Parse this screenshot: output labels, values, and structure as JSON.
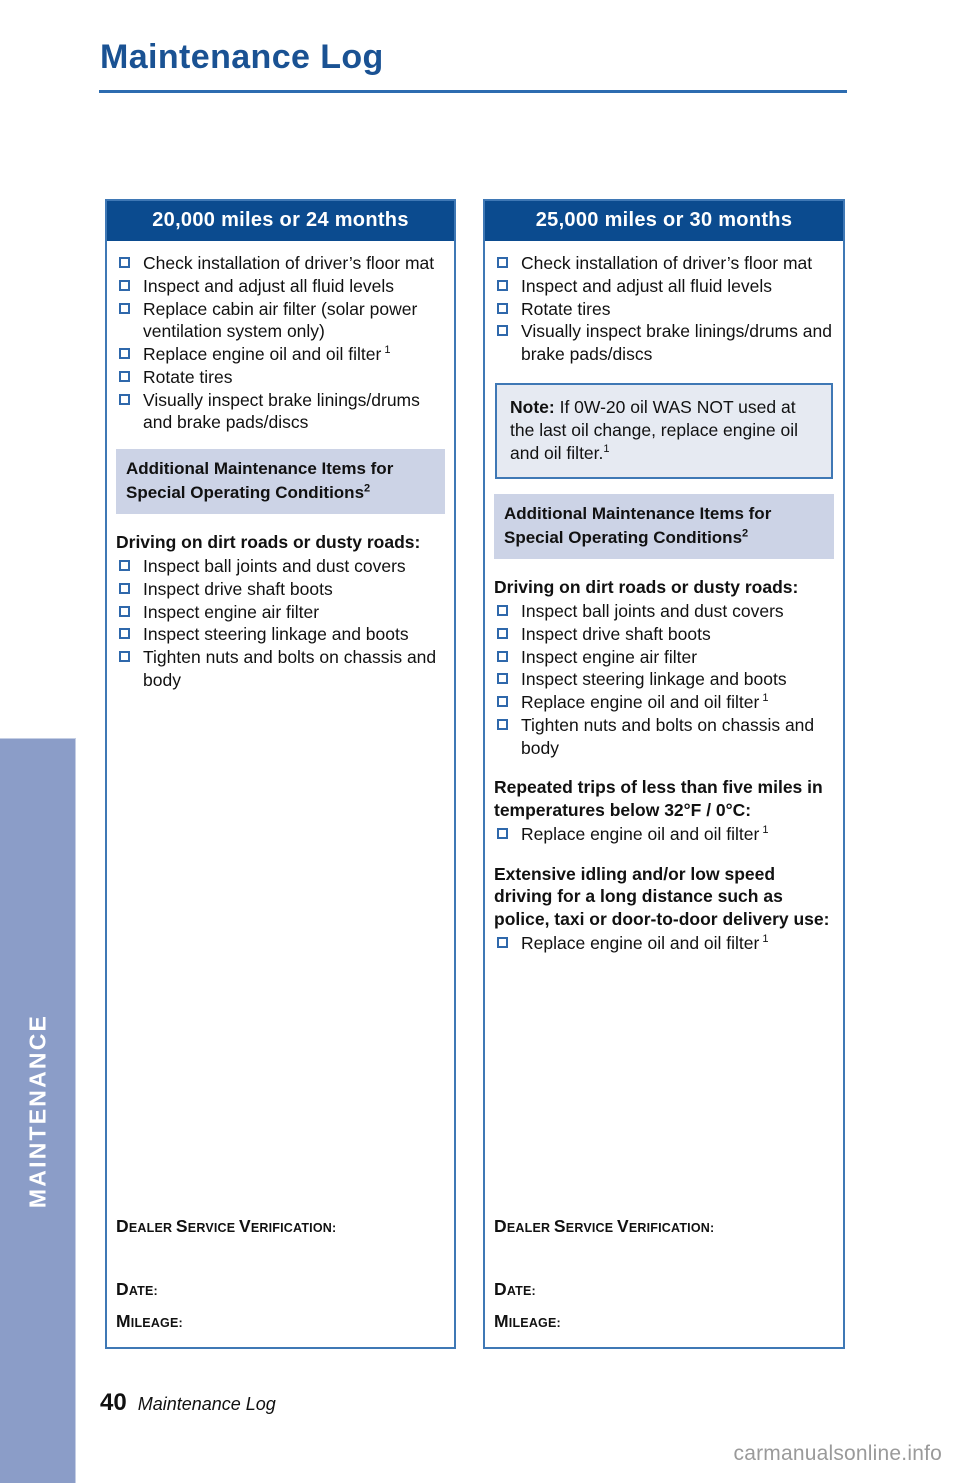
{
  "page": {
    "title": "Maintenance Log",
    "side_tab": "MAINTENANCE",
    "folio_number": "40",
    "folio_label": "Maintenance Log",
    "watermark": "carmanualsonline.info",
    "accent_blue": "#1a5293",
    "header_band": "#0b4b8f",
    "rule_blue": "#2d6cb0",
    "box_border": "#3f78b5",
    "gray_band": "#ccd3e6",
    "note_fill": "#e6eaf2",
    "tab_fill": "#8b9dc8"
  },
  "columns": [
    {
      "header": "20,000 miles or 24 months",
      "items": [
        "Check installation of driver’s floor mat",
        "Inspect and adjust all fluid levels",
        "Replace cabin air filter (solar power ventilation system only)",
        "Replace engine oil and oil filter",
        "Rotate tires",
        "Visually inspect brake linings/drums and brake pads/discs"
      ],
      "item_footnotes": [
        "",
        "",
        "",
        "1",
        "",
        ""
      ],
      "note": null,
      "gray_band": {
        "line1": "Additional Maintenance Items for",
        "line2": "Special Operating Conditions",
        "footnote": "2"
      },
      "sections": [
        {
          "subhead": "Driving on dirt roads or dusty roads:",
          "items": [
            "Inspect ball joints and dust covers",
            "Inspect drive shaft boots",
            "Inspect engine air filter",
            "Inspect steering linkage and boots",
            "Tighten nuts and bolts on chassis and body"
          ],
          "item_footnotes": [
            "",
            "",
            "",
            "",
            ""
          ]
        }
      ],
      "verification": {
        "title_first": "D",
        "title_rest": "EALER ",
        "title": "Dealer Service Verification:",
        "date": "Date:",
        "mileage": "Mileage:"
      }
    },
    {
      "header": "25,000 miles or 30 months",
      "items": [
        "Check installation of driver’s floor mat",
        "Inspect and adjust all fluid levels",
        "Rotate tires",
        "Visually inspect brake linings/drums and brake pads/discs"
      ],
      "item_footnotes": [
        "",
        "",
        "",
        ""
      ],
      "note": {
        "label": "Note:",
        "text": " If 0W-20 oil WAS NOT used at the last oil change, replace engine oil and oil filter.",
        "footnote": "1"
      },
      "gray_band": {
        "line1": "Additional Maintenance Items for",
        "line2": "Special Operating Conditions",
        "footnote": "2"
      },
      "sections": [
        {
          "subhead": "Driving on dirt roads or dusty roads:",
          "items": [
            "Inspect ball joints and dust covers",
            "Inspect drive shaft boots",
            "Inspect engine air filter",
            "Inspect steering linkage and boots",
            "Replace engine oil and oil filter",
            "Tighten nuts and bolts on chassis and body"
          ],
          "item_footnotes": [
            "",
            "",
            "",
            "",
            "1",
            ""
          ]
        },
        {
          "subhead": "Repeated trips of less than five miles in temperatures below 32°F / 0°C:",
          "items": [
            "Replace engine oil and oil filter"
          ],
          "item_footnotes": [
            "1"
          ]
        },
        {
          "subhead": "Extensive idling and/or low speed driving for a long distance such as police, taxi or door-to-door delivery use:",
          "items": [
            "Replace engine oil and oil filter"
          ],
          "item_footnotes": [
            "1"
          ]
        }
      ],
      "verification": {
        "title": "Dealer Service Verification:",
        "date": "Date:",
        "mileage": "Mileage:"
      }
    }
  ]
}
